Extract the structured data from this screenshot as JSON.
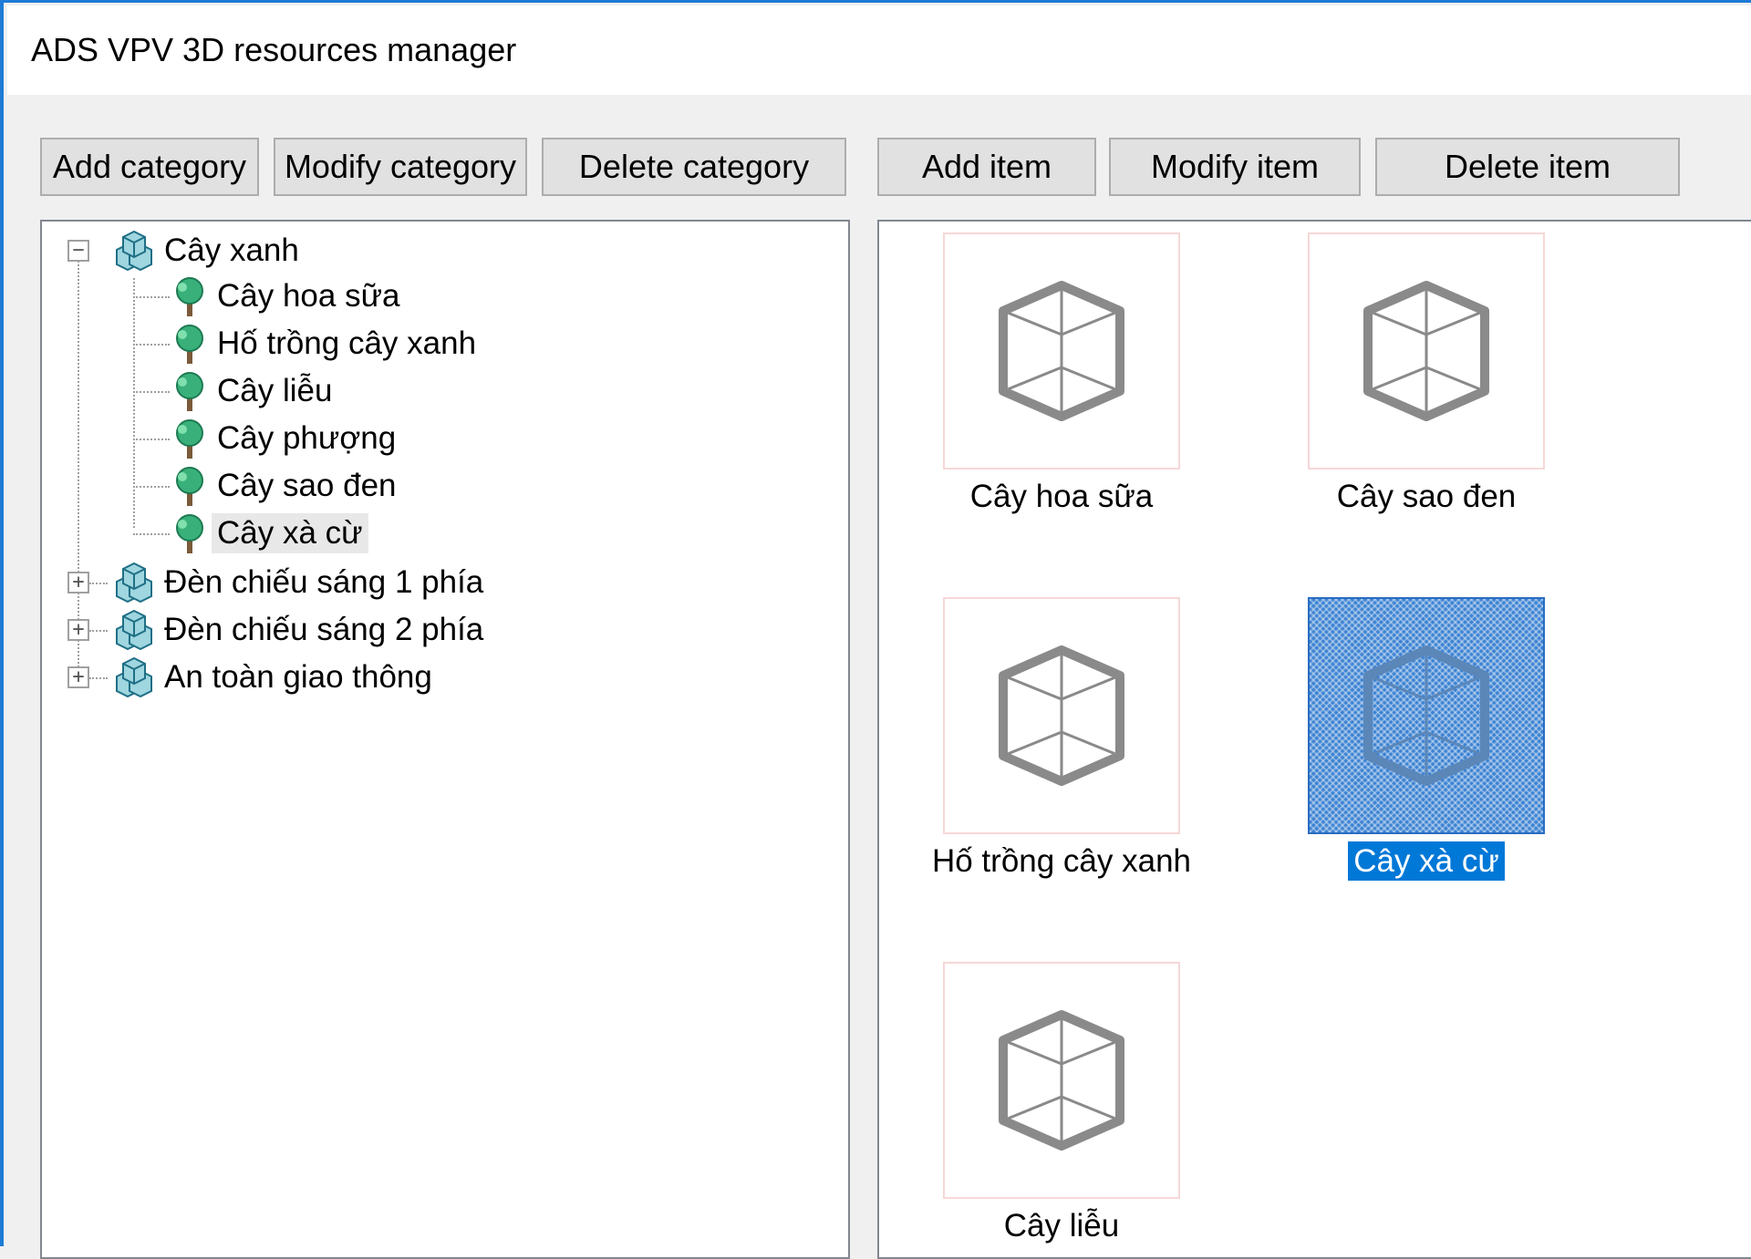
{
  "window": {
    "title": "ADS VPV 3D resources manager",
    "accent": "#1e7bd6"
  },
  "toolbar": {
    "add_category": "Add category",
    "modify_category": "Modify category",
    "delete_category": "Delete category",
    "add_item": "Add item",
    "modify_item": "Modify item",
    "delete_item": "Delete item"
  },
  "tree": {
    "categories": [
      {
        "label": "Cây xanh",
        "expanded": true,
        "icon": "category-cubes-icon"
      },
      {
        "label": "Đèn chiếu sáng 1 phía",
        "expanded": false,
        "icon": "category-cubes-icon"
      },
      {
        "label": "Đèn chiếu sáng 2 phía",
        "expanded": false,
        "icon": "category-cubes-icon"
      },
      {
        "label": "An toàn giao thông",
        "expanded": false,
        "icon": "category-cubes-icon"
      }
    ],
    "children": [
      {
        "label": "Cây hoa sữa",
        "icon": "tree-icon"
      },
      {
        "label": "Hố trồng cây xanh",
        "icon": "tree-icon"
      },
      {
        "label": "Cây liễu",
        "icon": "tree-icon"
      },
      {
        "label": "Cây phượng",
        "icon": "tree-icon"
      },
      {
        "label": "Cây sao đen",
        "icon": "tree-icon"
      },
      {
        "label": "Cây xà cừ",
        "icon": "tree-icon",
        "highlighted": true
      }
    ],
    "expand_symbol": "+",
    "collapse_symbol": "−"
  },
  "items": [
    {
      "label": "Cây hoa sữa",
      "icon": "cube-icon",
      "selected": false
    },
    {
      "label": "Cây sao đen",
      "icon": "cube-icon",
      "selected": false
    },
    {
      "label": "Hố trồng cây xanh",
      "icon": "cube-icon",
      "selected": false
    },
    {
      "label": "Cây xà cừ",
      "icon": "cube-icon",
      "selected": true
    },
    {
      "label": "Cây liễu",
      "icon": "cube-icon",
      "selected": false
    }
  ],
  "colors": {
    "selection": "#0078d7",
    "cube_stroke": "#8a8a8a",
    "button_bg": "#e1e1e1"
  }
}
